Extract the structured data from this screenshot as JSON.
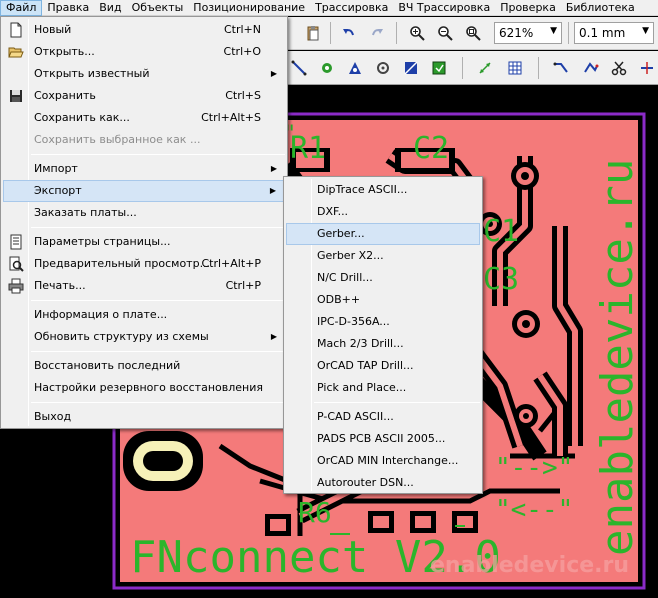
{
  "menubar": [
    {
      "label": "Файл",
      "active": true
    },
    {
      "label": "Правка"
    },
    {
      "label": "Вид"
    },
    {
      "label": "Объекты"
    },
    {
      "label": "Позиционирование"
    },
    {
      "label": "Трассировка"
    },
    {
      "label": "ВЧ Трассировка"
    },
    {
      "label": "Проверка"
    },
    {
      "label": "Библиотека"
    }
  ],
  "toolbar": {
    "zoom": "621%",
    "grid": "0.1 mm"
  },
  "file_menu": {
    "items": [
      {
        "label": "Новый",
        "shortcut": "Ctrl+N",
        "icon": "new-file-icon"
      },
      {
        "label": "Открыть...",
        "shortcut": "Ctrl+O",
        "icon": "open-folder-icon"
      },
      {
        "label": "Открыть известный",
        "submenu": true
      },
      {
        "label": "Сохранить",
        "shortcut": "Ctrl+S",
        "icon": "save-disk-icon"
      },
      {
        "label": "Сохранить как...",
        "shortcut": "Ctrl+Alt+S"
      },
      {
        "label": "Сохранить выбранное как ...",
        "disabled": true
      },
      {
        "label": "Импорт",
        "submenu": true
      },
      {
        "label": "Экспорт",
        "submenu": true,
        "highlighted": true
      },
      {
        "label": "Заказать платы..."
      },
      {
        "label": "Параметры страницы...",
        "icon": "page-setup-icon"
      },
      {
        "label": "Предварительный просмотр...",
        "shortcut": "Ctrl+Alt+P",
        "icon": "print-preview-icon"
      },
      {
        "label": "Печать...",
        "shortcut": "Ctrl+P",
        "icon": "printer-icon"
      },
      {
        "label": "Информация о плате..."
      },
      {
        "label": "Обновить структуру из схемы",
        "submenu": true
      },
      {
        "label": "Восстановить последний"
      },
      {
        "label": "Настройки резервного восстановления"
      },
      {
        "label": "Выход"
      }
    ]
  },
  "export_menu": {
    "items": [
      {
        "label": "DipTrace ASCII..."
      },
      {
        "label": "DXF..."
      },
      {
        "label": "Gerber...",
        "highlighted": true
      },
      {
        "label": "Gerber X2..."
      },
      {
        "label": "N/C Drill..."
      },
      {
        "label": "ODB++"
      },
      {
        "label": "IPC-D-356A..."
      },
      {
        "label": "Mach 2/3 Drill..."
      },
      {
        "label": "OrCAD TAP Drill..."
      },
      {
        "label": "Pick and Place..."
      },
      {
        "label": "P-CAD ASCII..."
      },
      {
        "label": "PADS PCB ASCII 2005..."
      },
      {
        "label": "OrCAD MIN Interchange..."
      },
      {
        "label": "Autorouter DSN..."
      }
    ]
  },
  "pcb": {
    "labels": {
      "r1": "R1",
      "c2": "C2",
      "c1": "C1",
      "c3": "C3",
      "r6": "R6",
      "title": "FNconnect V2.0",
      "arrow_right": "\"-->\"",
      "arrow_left": "\"<--\"",
      "watermark_vertical": "enabledevice.ru",
      "watermark_bottom": "enabledevice.ru"
    },
    "colors": {
      "board": "#f47a7a",
      "silk": "#2bb52b",
      "outline": "#8b2bc8",
      "background": "#000000"
    }
  }
}
